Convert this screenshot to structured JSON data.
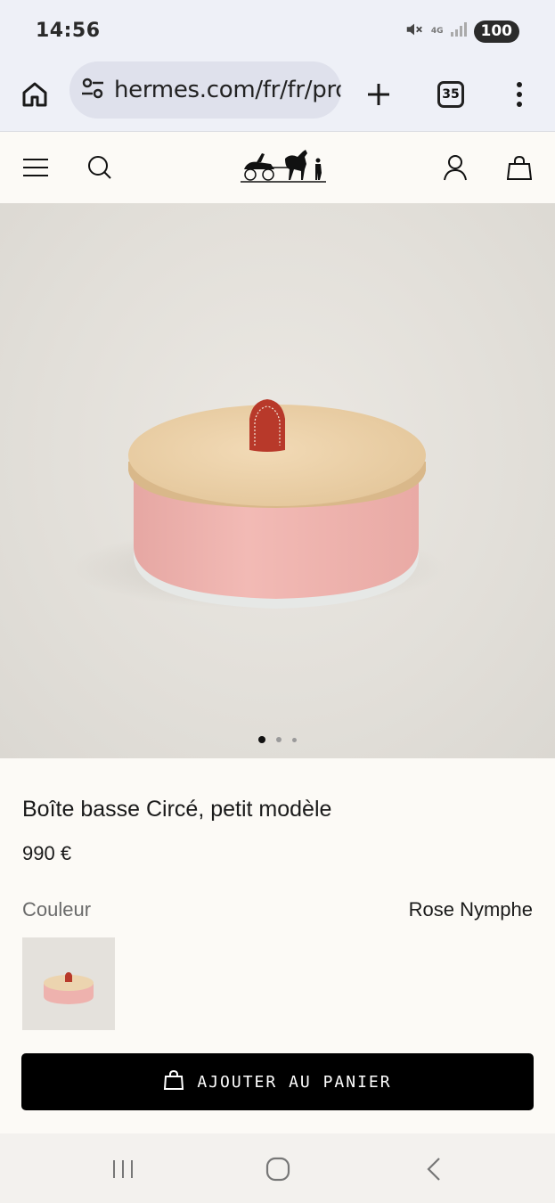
{
  "status_bar": {
    "time": "14:56",
    "network": "4G",
    "battery": "100"
  },
  "browser": {
    "url": "hermes.com/fr/fr/product/boite-basse-circe",
    "tab_count": "35"
  },
  "product": {
    "title": "Boîte basse Circé, petit modèle",
    "price": "990 €",
    "color_label": "Couleur",
    "color_value": "Rose Nymphe",
    "image_count": 3,
    "active_image": 1
  },
  "cta": {
    "label": "AJOUTER AU PANIER"
  },
  "icons": {
    "home": "home-icon",
    "site_settings": "tune-icon",
    "new_tab": "plus-icon",
    "tabs": "tabs-icon",
    "more": "more-vert-icon",
    "menu": "menu-icon",
    "search": "search-icon",
    "logo": "hermes-carriage-logo",
    "account": "user-icon",
    "cart": "shopping-bag-icon",
    "recents": "recents-icon",
    "nav_home": "nav-home-icon",
    "back": "back-icon"
  },
  "colors": {
    "background": "#fcfaf6",
    "cta": "#000000",
    "browser_bar": "#eef0f7",
    "product_pink": "#eeb2ae"
  }
}
